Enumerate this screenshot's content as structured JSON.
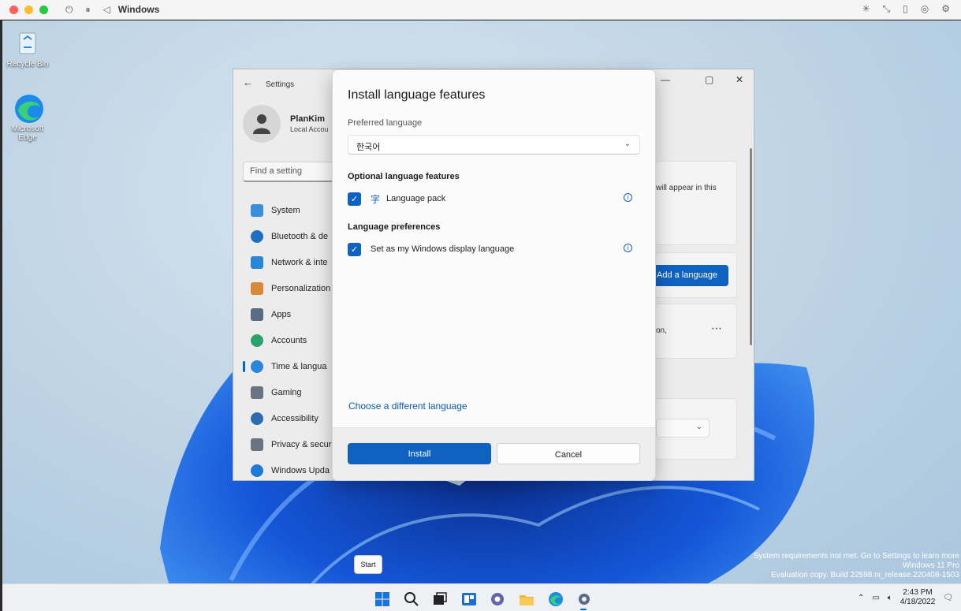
{
  "vm": {
    "title": "Windows"
  },
  "desktop": {
    "icons": [
      {
        "label": "Recycle Bin"
      },
      {
        "label": "Microsoft Edge"
      }
    ],
    "watermark": {
      "line1": "System requirements not met. Go to Settings to learn more",
      "line2": "Windows 11 Pro",
      "line3": "Evaluation copy. Build 22598.ni_release.220408-1503"
    }
  },
  "settings": {
    "title": "Settings",
    "user": {
      "name": "PlanKim",
      "account": "Local Accou"
    },
    "search_placeholder": "Find a setting",
    "nav": [
      {
        "label": "System",
        "color": "#3a8fd8"
      },
      {
        "label": "Bluetooth & de",
        "color": "#1f6fc0"
      },
      {
        "label": "Network & inte",
        "color": "#2a86d6"
      },
      {
        "label": "Personalization",
        "color": "#d88a3a"
      },
      {
        "label": "Apps",
        "color": "#5a6b85"
      },
      {
        "label": "Accounts",
        "color": "#2aa36b"
      },
      {
        "label": "Time & langua",
        "color": "#2b88d8"
      },
      {
        "label": "Gaming",
        "color": "#6b7280"
      },
      {
        "label": "Accessibility",
        "color": "#2b6cb0"
      },
      {
        "label": "Privacy & secur",
        "color": "#6b7280"
      },
      {
        "label": "Windows Upda",
        "color": "#1f7ad6"
      }
    ],
    "bg_text": {
      "appear": "will appear in this",
      "on": "on,",
      "add_language": "Add a language"
    }
  },
  "dialog": {
    "title": "Install language features",
    "preferred_label": "Preferred language",
    "preferred_value": "한국어",
    "optional_heading": "Optional language features",
    "language_pack": "Language pack",
    "preferences_heading": "Language preferences",
    "display_language": "Set as my Windows display language",
    "choose_link": "Choose a different language",
    "install": "Install",
    "cancel": "Cancel",
    "accent": "#0f62c2"
  },
  "taskbar": {
    "tooltip": "Start",
    "time": "2:43 PM",
    "date": "4/18/2022"
  }
}
